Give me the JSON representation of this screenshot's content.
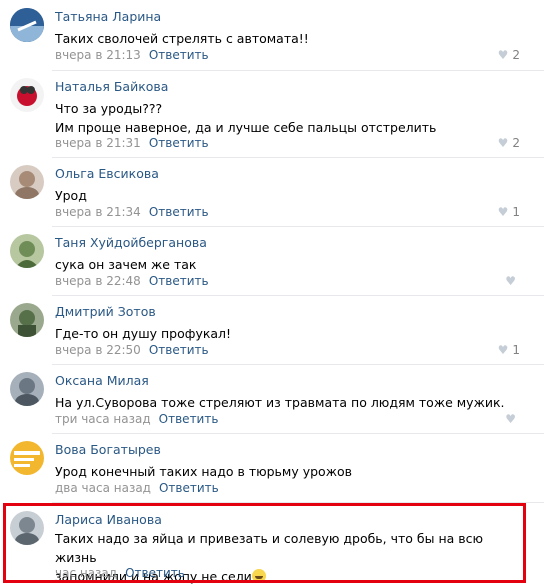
{
  "comments": [
    {
      "author": "Татьяна Ларина",
      "text": "Таких сволочей стрелять с автомата!!",
      "time": "вчера в 21:13",
      "reply": "Ответить",
      "likes": "2",
      "avatar_color": "#2f5f97"
    },
    {
      "author": "Наталья Байкова",
      "text1": "Что за уроды???",
      "text2": "Им проще наверное, да и лучше себе пальцы отстрелить",
      "time": "вчера в 21:31",
      "reply": "Ответить",
      "likes": "2",
      "avatar_color": "#c8102e"
    },
    {
      "author": "Ольга Евсикова",
      "text": "Урод",
      "time": "вчера в 21:34",
      "reply": "Ответить",
      "likes": "1",
      "avatar_color": "#b9a79a"
    },
    {
      "author": "Таня Хуйдойберганова",
      "text": "сука он зачем же так",
      "time": "вчера в 22:48",
      "reply": "Ответить",
      "likes": "",
      "avatar_color": "#6f8d57"
    },
    {
      "author": "Дмитрий Зотов",
      "text": "Где-то он душу профукал!",
      "time": "вчера в 22:50",
      "reply": "Ответить",
      "likes": "1",
      "avatar_color": "#56704a"
    },
    {
      "author": "Оксана Милая",
      "text": "На ул.Суворова тоже стреляют из травмата по людям тоже мужик.",
      "time": "три часа назад",
      "reply": "Ответить",
      "likes": "",
      "avatar_color": "#6b7884"
    },
    {
      "author": "Вова Богатырев",
      "text": "Урод конечный таких надо в тюрьму урожов",
      "time": "два часа назад",
      "reply": "Ответить",
      "likes": "",
      "avatar_color": "#f2b72f"
    },
    {
      "author": "Лариса Иванова",
      "text1": "Таких надо за яйца и привезать и солевую дробь, что бы на всю жизнь",
      "text2": "запомнили и на жопу не сели",
      "time": "час назад",
      "reply": "Ответить",
      "likes": "",
      "avatar_color": "#7c8790"
    }
  ],
  "colors": {
    "link": "#2a5885",
    "meta": "#939393",
    "highlight": "#e3000f"
  }
}
